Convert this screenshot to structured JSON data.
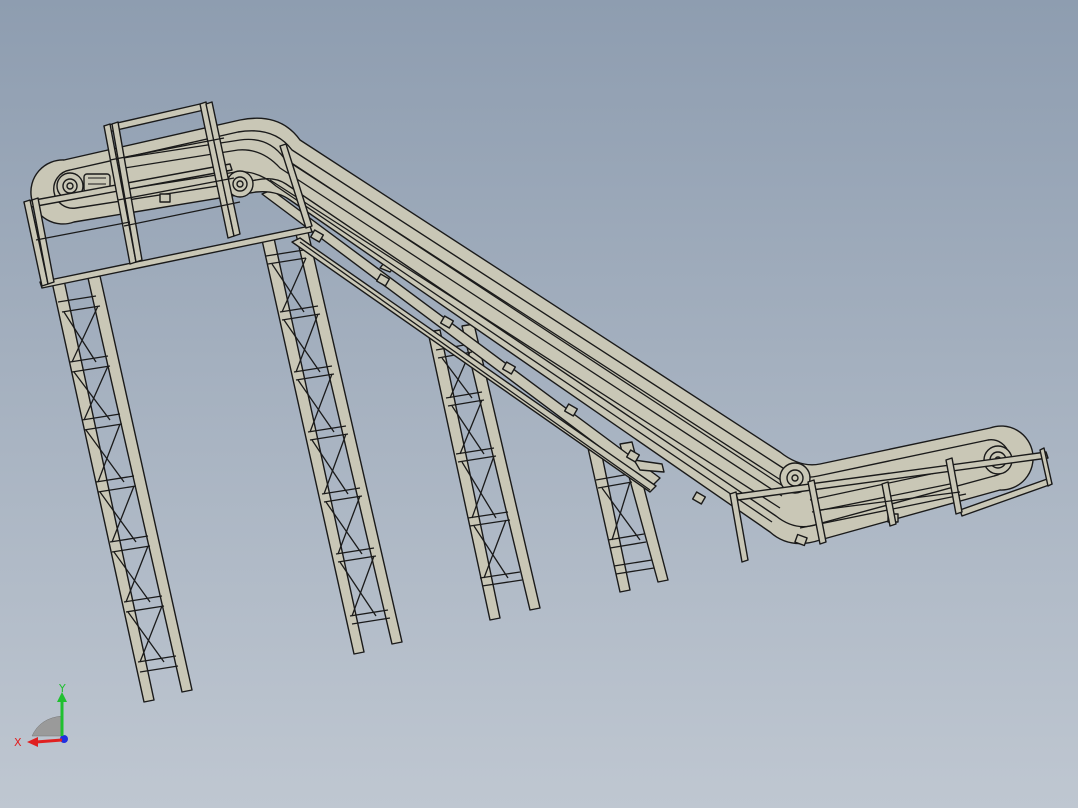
{
  "viewport": {
    "background_top": "#8e9db0",
    "background_bottom": "#bfc7d1",
    "model_face_color": "#c9c7b6",
    "model_edge_color": "#1a1a1a"
  },
  "triad": {
    "x_label": "X",
    "y_label": "Y",
    "x_color": "#e02020",
    "y_color": "#20c030",
    "z_color": "#2030e0"
  }
}
